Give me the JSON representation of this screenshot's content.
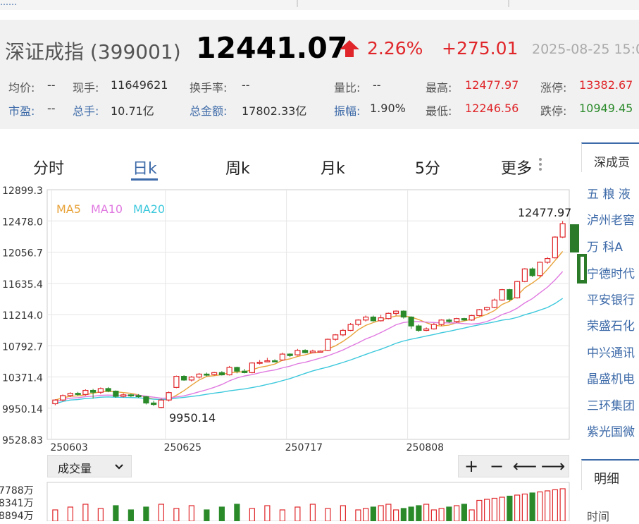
{
  "quote": {
    "name": "深证成指 (399001)",
    "price": "12441.07",
    "pct": "2.26%",
    "change": "+275.01",
    "time": "2025-08-25 15:0"
  },
  "stats": {
    "avg_label": "均价:",
    "avg_value": "--",
    "current_hand_label": "现手:",
    "current_hand_value": "11649621",
    "turnover_label": "换手率:",
    "turnover_value": "--",
    "vol_ratio_label": "量比:",
    "vol_ratio_value": "--",
    "high_label": "最高:",
    "high_value": "12477.97",
    "limit_up_label": "涨停:",
    "limit_up_value": "13382.67",
    "pe_label": "市盈:",
    "pe_value": "--",
    "total_hand_label": "总手:",
    "total_hand_value": "10.71亿",
    "amount_label": "总金额:",
    "amount_value": "17802.33亿",
    "amplitude_label": "振幅:",
    "amplitude_value": "1.90%",
    "low_label": "最低:",
    "low_value": "12246.56",
    "limit_down_label": "跌停:",
    "limit_down_value": "10949.45"
  },
  "tabs": [
    "分时",
    "日k",
    "周k",
    "月k",
    "5分",
    "更多"
  ],
  "active_tab": 1,
  "chart_data": {
    "type": "candlestick",
    "y_ticks": [
      "12899.3",
      "12478.0",
      "12056.7",
      "11635.4",
      "11214.0",
      "10792.7",
      "10371.4",
      "9950.14",
      "9528.83"
    ],
    "ylim": [
      9528.83,
      12899.3
    ],
    "x_ticks": [
      {
        "label": "250603",
        "index": 0
      },
      {
        "label": "250625",
        "index": 15
      },
      {
        "label": "250717",
        "index": 31
      },
      {
        "label": "250808",
        "index": 47
      }
    ],
    "legend": [
      {
        "name": "MA5",
        "color": "#e8a33a"
      },
      {
        "name": "MA10",
        "color": "#e07ae0"
      },
      {
        "name": "MA20",
        "color": "#3cc8dc"
      }
    ],
    "annotations": {
      "high": "12477.97",
      "low": "9950.14"
    },
    "candles": [
      [
        10010,
        10060,
        9990,
        10070
      ],
      [
        10060,
        10120,
        10040,
        10135
      ],
      [
        10120,
        10150,
        10100,
        10165
      ],
      [
        10150,
        10135,
        10115,
        10170
      ],
      [
        10135,
        10190,
        10120,
        10205
      ],
      [
        10190,
        10165,
        10080,
        10210
      ],
      [
        10165,
        10215,
        10140,
        10230
      ],
      [
        10215,
        10180,
        10165,
        10235
      ],
      [
        10180,
        10110,
        10090,
        10190
      ],
      [
        10110,
        10130,
        10095,
        10150
      ],
      [
        10130,
        10120,
        10100,
        10145
      ],
      [
        10120,
        10105,
        10090,
        10140
      ],
      [
        10105,
        10020,
        10000,
        10115
      ],
      [
        10020,
        10000,
        9980,
        10050
      ],
      [
        9960,
        10060,
        9950,
        10080
      ],
      [
        10060,
        10160,
        10040,
        10175
      ],
      [
        10230,
        10380,
        10220,
        10390
      ],
      [
        10380,
        10330,
        10320,
        10395
      ],
      [
        10330,
        10370,
        10310,
        10385
      ],
      [
        10370,
        10410,
        10350,
        10425
      ],
      [
        10410,
        10405,
        10380,
        10430
      ],
      [
        10405,
        10430,
        10390,
        10440
      ],
      [
        10430,
        10400,
        10390,
        10450
      ],
      [
        10400,
        10500,
        10390,
        10520
      ],
      [
        10500,
        10450,
        10420,
        10510
      ],
      [
        10450,
        10430,
        10420,
        10480
      ],
      [
        10430,
        10560,
        10420,
        10570
      ],
      [
        10560,
        10570,
        10540,
        10600
      ],
      [
        10580,
        10590,
        10570,
        10630
      ],
      [
        10590,
        10580,
        10575,
        10610
      ],
      [
        10600,
        10680,
        10590,
        10700
      ],
      [
        10680,
        10660,
        10640,
        10690
      ],
      [
        10670,
        10730,
        10660,
        10750
      ],
      [
        10730,
        10700,
        10690,
        10745
      ],
      [
        10700,
        10720,
        10690,
        10740
      ],
      [
        10720,
        10720,
        10700,
        10730
      ],
      [
        10730,
        10880,
        10720,
        10890
      ],
      [
        10880,
        10940,
        10860,
        10950
      ],
      [
        10940,
        11000,
        10920,
        11020
      ],
      [
        11000,
        11080,
        10990,
        11100
      ],
      [
        11080,
        11140,
        11060,
        11150
      ],
      [
        11140,
        11180,
        11120,
        11200
      ],
      [
        11180,
        11130,
        11120,
        11200
      ],
      [
        11130,
        11170,
        11120,
        11210
      ],
      [
        11160,
        11230,
        11150,
        11240
      ],
      [
        11230,
        11260,
        11200,
        11270
      ],
      [
        11260,
        11180,
        11160,
        11270
      ],
      [
        11180,
        11060,
        11020,
        11190
      ],
      [
        11060,
        11000,
        10980,
        11080
      ],
      [
        11000,
        11020,
        10990,
        11040
      ],
      [
        11020,
        11080,
        11010,
        11100
      ],
      [
        11080,
        11140,
        11060,
        11150
      ],
      [
        11140,
        11120,
        11100,
        11160
      ],
      [
        11120,
        11160,
        11100,
        11170
      ],
      [
        11160,
        11140,
        11130,
        11170
      ],
      [
        11140,
        11200,
        11130,
        11210
      ],
      [
        11200,
        11280,
        11190,
        11290
      ],
      [
        11280,
        11310,
        11260,
        11320
      ],
      [
        11310,
        11410,
        11300,
        11430
      ],
      [
        11410,
        11550,
        11400,
        11560
      ],
      [
        11550,
        11420,
        11400,
        11560
      ],
      [
        11440,
        11660,
        11430,
        11670
      ],
      [
        11660,
        11830,
        11650,
        11840
      ],
      [
        11830,
        11740,
        11720,
        11850
      ],
      [
        11740,
        11920,
        11720,
        11930
      ],
      [
        11920,
        11970,
        11900,
        11990
      ],
      [
        11980,
        12260,
        11970,
        12270
      ],
      [
        12260,
        12441,
        12247,
        12478
      ]
    ],
    "volume_ticks": [
      "7788万",
      "8341万",
      "8894万"
    ]
  },
  "toolbar": {
    "select_label": "成交量",
    "zoom_in": "+",
    "zoom_out": "−",
    "left": "⟵",
    "right": "⟶"
  },
  "sidebar": {
    "header": "深成贡",
    "stocks": [
      "五 粮 液",
      "泸州老窖",
      "万 科A",
      "宁德时代",
      "平安银行",
      "荣盛石化",
      "中兴通讯",
      "晶盛机电",
      "三环集团",
      "紫光国微"
    ],
    "detail_header": "明细",
    "time_label": "时间"
  },
  "colors": {
    "up": "#e0262a",
    "down": "#2a8a2a",
    "link": "#3d6aa8"
  }
}
